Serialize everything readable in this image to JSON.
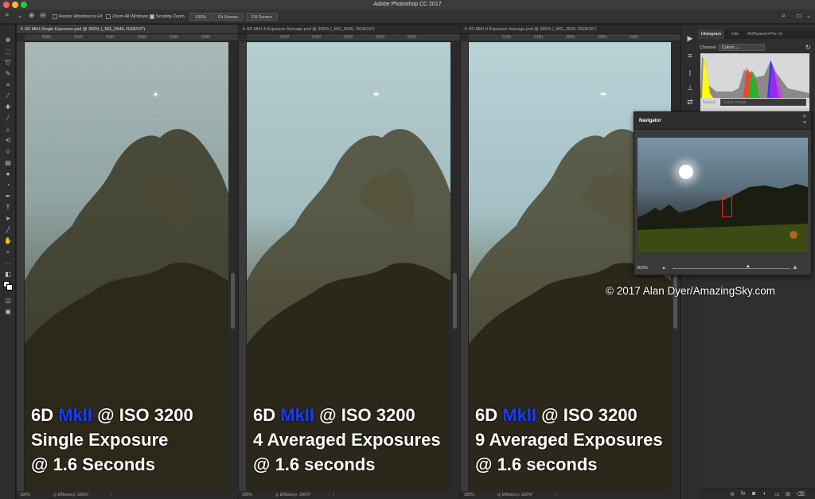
{
  "app": {
    "title": "Adobe Photoshop CC 2017"
  },
  "options_bar": {
    "resize_windows": "Resize Windows to Fit",
    "zoom_all": "Zoom All Windows",
    "scrubby_zoom": "Scrubby Zoom",
    "zoom_value": "100%",
    "fit_screen": "Fit Screen",
    "fill_screen": "Fill Screen"
  },
  "documents": [
    {
      "tab": "6D MkII-Single Exposure.psd @ 300% (_MG_0644, RGB/16*)",
      "ruler": [
        "5050",
        "5100",
        "5150",
        "5200",
        "5250",
        "5300"
      ],
      "status_zoom": "300%",
      "status_info": "Efficiency: 100%*",
      "overlay": {
        "line1_pre": "6D ",
        "line1_mk": "MkII",
        "line1_post": " @ ISO 3200",
        "line2": "Single Exposure",
        "line3": "@ 1.6 Seconds"
      }
    },
    {
      "tab": "6D MkII-4 Exposure Average.psd @ 300% (_MG_0645, RGB/16*)",
      "ruler": [
        "5100",
        "5150",
        "5200",
        "5250",
        "5300"
      ],
      "status_zoom": "300%",
      "status_info": "Efficiency: 100%*",
      "overlay": {
        "line1_pre": "6D ",
        "line1_mk": "MkII",
        "line1_post": " @ ISO 3200",
        "line2": "4 Averaged Exposures",
        "line3": "@ 1.6 seconds"
      }
    },
    {
      "tab": "6D MkII-9 Exposure Average.psd @ 300% (_MG_0646, RGB/16*)",
      "ruler": [
        "5100",
        "5150",
        "5200",
        "5250",
        "5300"
      ],
      "status_zoom": "300%",
      "status_info": "Efficiency: 100%*",
      "overlay": {
        "line1_pre": "6D ",
        "line1_mk": "MkII",
        "line1_post": " @ ISO 3200",
        "line2": "9 Averaged Exposures",
        "line3": "@ 1.6 seconds"
      }
    }
  ],
  "panel": {
    "tabs": [
      "Histogram",
      "Info",
      "ADPpanel+Pro v2"
    ],
    "channel_label": "Channel:",
    "channel_value": "Colors",
    "source_label": "Source:",
    "source_value": "Entire Image"
  },
  "navigator": {
    "title": "Navigator",
    "zoom": "300%"
  },
  "copyright": "© 2017 Alan Dyer/AmazingSky.com"
}
